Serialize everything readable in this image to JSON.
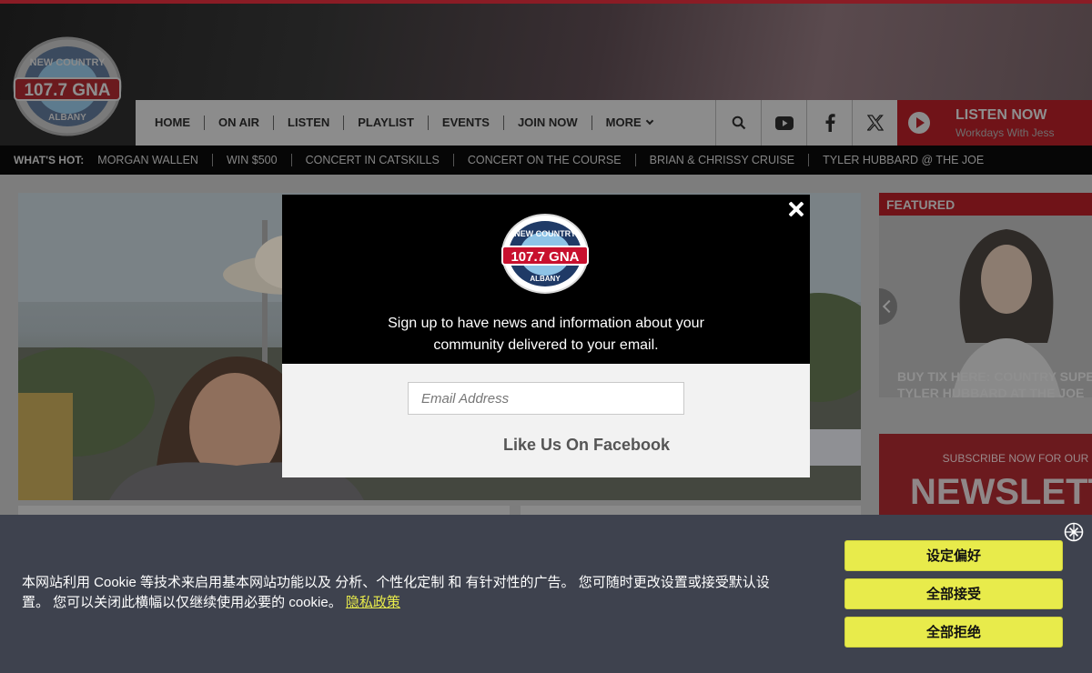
{
  "station": {
    "logo_top": "NEW COUNTRY",
    "logo_main": "107.7 GNA",
    "logo_bottom": "ALBANY"
  },
  "nav": {
    "items": [
      "HOME",
      "ON AIR",
      "LISTEN",
      "PLAYLIST",
      "EVENTS",
      "JOIN NOW"
    ],
    "more_label": "MORE"
  },
  "header_icons": [
    "search-icon",
    "youtube-icon",
    "facebook-icon",
    "x-icon"
  ],
  "listen_now": {
    "title": "LISTEN NOW",
    "subtitle": "Workdays With Jess"
  },
  "whats_hot": {
    "label": "WHAT'S HOT:",
    "items": [
      "MORGAN WALLEN",
      "WIN $500",
      "CONCERT IN CATSKILLS",
      "CONCERT ON THE COURSE",
      "BRIAN & CHRISSY CRUISE",
      "TYLER HUBBARD @ THE JOE"
    ]
  },
  "featured": {
    "label": "FEATURED",
    "headline_line1": "BUY TIX HERE: COUNTRY SUPERSTAR",
    "headline_line2": "TYLER HUBBARD AT THE JOE"
  },
  "newsletter": {
    "subtitle": "SUBSCRIBE NOW FOR OUR",
    "title": "NEWSLETTER"
  },
  "modal": {
    "text_line1": "Sign up to have news and information about your",
    "text_line2": "community delivered to your email.",
    "email_placeholder": "Email Address",
    "facebook_label": "Like Us On Facebook"
  },
  "cookie": {
    "text_line1": "本网站利用 Cookie 等技术来启用基本网站功能以及 分析、个性化定制 和 有针对性的广告。 您可随时更改设置或接受默认设",
    "text_line2": "置。 您可以关闭此横幅以仅继续使用必要的 cookie。",
    "link_label": "隐私政策",
    "buttons": [
      "设定偏好",
      "全部接受",
      "全部拒绝"
    ]
  },
  "colors": {
    "accent_red": "#c8102e",
    "cookie_bg": "#3e424e",
    "cookie_button": "#e8eb4b"
  }
}
